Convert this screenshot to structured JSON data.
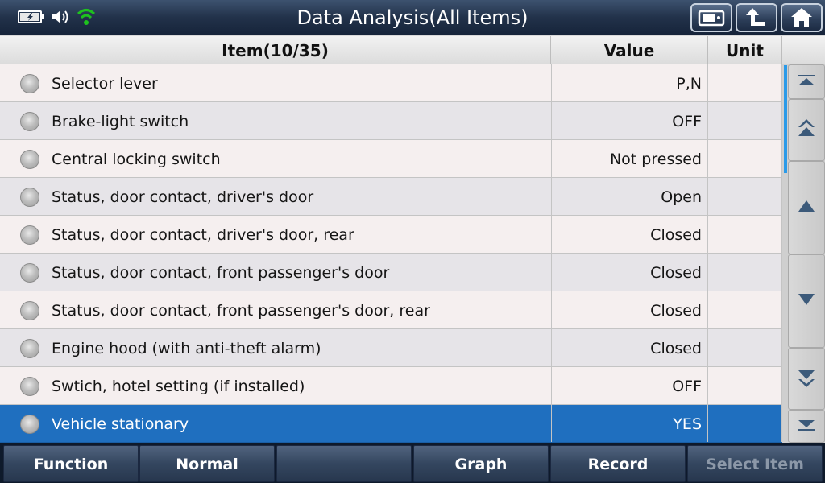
{
  "header": {
    "title": "Data Analysis(All Items)",
    "status_icons": [
      "battery-charging-icon",
      "speaker-icon",
      "wifi-icon"
    ],
    "buttons": [
      "screenshot-icon",
      "back-icon",
      "home-icon"
    ],
    "accent_wifi": "#1ec21e"
  },
  "table": {
    "columns": {
      "item": "Item(10/35)",
      "value": "Value",
      "unit": "Unit"
    },
    "rows": [
      {
        "item": "Selector lever",
        "value": "P,N",
        "unit": ""
      },
      {
        "item": "Brake-light switch",
        "value": "OFF",
        "unit": ""
      },
      {
        "item": "Central locking switch",
        "value": "Not pressed",
        "unit": ""
      },
      {
        "item": "Status, door contact, driver's door",
        "value": "Open",
        "unit": ""
      },
      {
        "item": "Status, door contact, driver's door, rear",
        "value": "Closed",
        "unit": ""
      },
      {
        "item": "Status, door contact, front passenger's door",
        "value": "Closed",
        "unit": ""
      },
      {
        "item": "Status, door contact, front passenger's door, rear",
        "value": "Closed",
        "unit": ""
      },
      {
        "item": "Engine hood (with anti-theft alarm)",
        "value": "Closed",
        "unit": ""
      },
      {
        "item": "Swtich, hotel setting (if installed)",
        "value": "OFF",
        "unit": ""
      },
      {
        "item": "Vehicle stationary",
        "value": "YES",
        "unit": ""
      }
    ],
    "selected_index": 9,
    "selection_color": "#1f6fbf"
  },
  "scroll": {
    "buttons": [
      "scroll-top-icon",
      "page-up-icon",
      "up-arrow-icon",
      "down-arrow-icon",
      "page-down-icon",
      "scroll-bottom-icon"
    ]
  },
  "footer": {
    "buttons": [
      {
        "label": "Function",
        "enabled": true
      },
      {
        "label": "Normal",
        "enabled": true
      },
      {
        "label": "",
        "enabled": true
      },
      {
        "label": "Graph",
        "enabled": true
      },
      {
        "label": "Record",
        "enabled": true
      },
      {
        "label": "Select Item",
        "enabled": false
      }
    ]
  }
}
